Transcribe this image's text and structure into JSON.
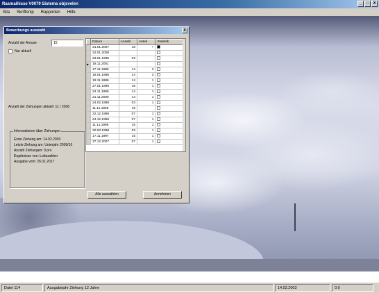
{
  "app": {
    "title": "Rasmaihisse V0079 Sistema objsvelen",
    "window_controls": [
      "_",
      "□",
      "X"
    ]
  },
  "menu": [
    "Sila",
    "Skriftsnip",
    "Rapporten",
    "Hilfe"
  ],
  "dialog": {
    "title": "Bewerbungs auswahl",
    "close": "X",
    "field_label": "Anzahl der Anruse",
    "field_value": "15",
    "checkbox_label": "Nur aktuell",
    "summary_label": "Anzahl der Ziehungen aktuell: 11 / 2008",
    "group": {
      "legend": "Informationen über Ziehungen",
      "lines": [
        "Erste Ziehung am: 14.02.2003",
        "Letzte Ziehung am: Unterjahr 2009/10",
        "Anzahl Ziehungen: 9 pro",
        "Ergebnisse von: Lottozahlen",
        "Ausgabe vom: 26.01.2017"
      ]
    },
    "grid": {
      "columns": [
        "Datum",
        "Anzahl",
        "Anteil",
        "Statistik"
      ],
      "rows": [
        {
          "date": "21.01.2007",
          "count": "18",
          "share": "+",
          "checked": true
        },
        {
          "date": "22.01.2008",
          "count": "",
          "share": "",
          "checked": false
        },
        {
          "date": "23.01.1995",
          "count": "03",
          "share": "",
          "checked": false
        },
        {
          "date": "19.11.2001",
          "count": "",
          "share": "",
          "checked": false
        },
        {
          "date": "17.11.1986",
          "count": "14",
          "share": "3",
          "checked": false
        },
        {
          "date": "18.01.1986",
          "count": "14",
          "share": "3",
          "checked": false
        },
        {
          "date": "19.11.1986",
          "count": "14",
          "share": "1",
          "checked": false
        },
        {
          "date": "27.01.1996",
          "count": "15",
          "share": "1",
          "checked": false
        },
        {
          "date": "24.11.1996",
          "count": "14",
          "share": "1",
          "checked": false
        },
        {
          "date": "21.11.2000",
          "count": "14",
          "share": "1",
          "checked": false
        },
        {
          "date": "24.02.1998",
          "count": "03",
          "share": "1",
          "checked": false
        },
        {
          "date": "11.11.1996",
          "count": "15",
          "share": "",
          "checked": false
        },
        {
          "date": "22.12.1998",
          "count": "07",
          "share": "1",
          "checked": false
        },
        {
          "date": "24.12.1996",
          "count": "07",
          "share": "1",
          "checked": false
        },
        {
          "date": "11.11.1998",
          "count": "15",
          "share": "1",
          "checked": false
        },
        {
          "date": "20.03.1998",
          "count": "03",
          "share": "1",
          "checked": false
        },
        {
          "date": "17.11.1997",
          "count": "15",
          "share": "1",
          "checked": false
        },
        {
          "date": "27.12.2007",
          "count": "07",
          "share": "1",
          "checked": false
        }
      ]
    },
    "buttons": {
      "select_all": "Alle auswählen",
      "accept": "Annehmen"
    }
  },
  "status": {
    "left": "Datei 114",
    "middle": "Ausgabejahr Ziehung 12 Jahre",
    "date": "14.02.2003",
    "right": "0.0"
  }
}
